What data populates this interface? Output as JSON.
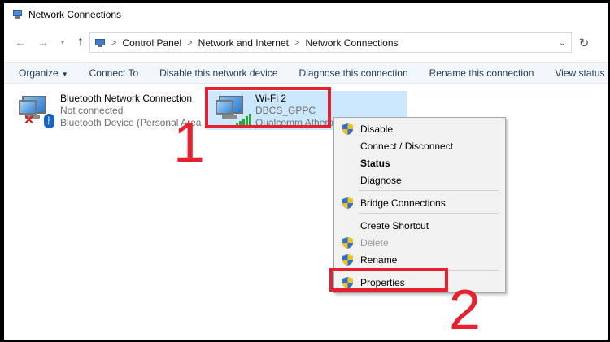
{
  "window": {
    "title": "Network Connections"
  },
  "nav": {
    "back": "←",
    "forward": "→",
    "up": "↑",
    "breadcrumb": [
      "Control Panel",
      "Network and Internet",
      "Network Connections"
    ],
    "dropdown": "⌄",
    "refresh": "↻"
  },
  "commands": {
    "organize": "Organize",
    "connect_to": "Connect To",
    "disable_device": "Disable this network device",
    "diagnose": "Diagnose this connection",
    "rename": "Rename this connection",
    "view_status": "View status of this connection"
  },
  "connections": [
    {
      "name": "Bluetooth Network Connection",
      "status": "Not connected",
      "device": "Bluetooth Device (Personal Area Network)",
      "icon": "bluetooth-network-icon"
    },
    {
      "name": "Wi-Fi 2",
      "status": "DBCS_GPPC",
      "device": "Qualcomm Atheros",
      "icon": "wifi-network-icon"
    }
  ],
  "context_menu": {
    "disable": "Disable",
    "connect_disconnect": "Connect / Disconnect",
    "status": "Status",
    "diagnose": "Diagnose",
    "bridge": "Bridge Connections",
    "create_shortcut": "Create Shortcut",
    "delete": "Delete",
    "rename": "Rename",
    "properties": "Properties"
  },
  "annotations": {
    "step1": "1",
    "step2": "2",
    "color": "#e5212f"
  },
  "colors": {
    "selection": "#cce8ff",
    "command_text": "#1e3957",
    "shield_blue": "#2b6fd0",
    "shield_yellow": "#f0c020"
  }
}
